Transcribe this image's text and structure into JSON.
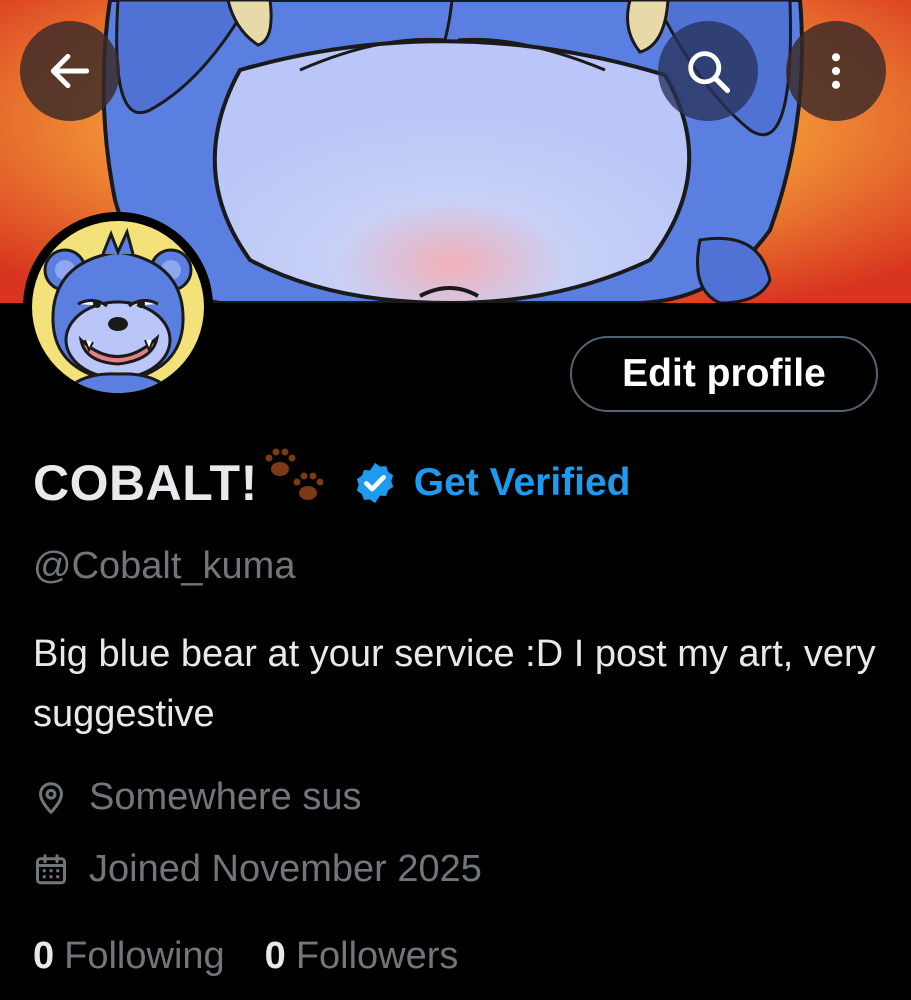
{
  "header": {
    "back_icon": "arrow-left-icon",
    "search_icon": "search-icon",
    "more_icon": "more-vertical-icon"
  },
  "profile": {
    "display_name": "COBALT!",
    "name_emoji": "paw-prints",
    "verified_badge_icon": "verified-badge-icon",
    "get_verified_label": "Get Verified",
    "handle": "@Cobalt_kuma",
    "bio": "Big blue bear at your service :D I post my art, very suggestive",
    "location": "Somewhere sus",
    "location_icon": "location-pin-icon",
    "joined": "Joined November 2025",
    "joined_icon": "calendar-icon",
    "edit_profile_label": "Edit profile"
  },
  "stats": {
    "following_count": "0",
    "following_label": "Following",
    "followers_count": "0",
    "followers_label": "Followers"
  },
  "colors": {
    "background": "#000000",
    "primary_text": "#e7e9ea",
    "secondary_text": "#71767b",
    "accent": "#1d9bf0",
    "border": "#536471"
  }
}
